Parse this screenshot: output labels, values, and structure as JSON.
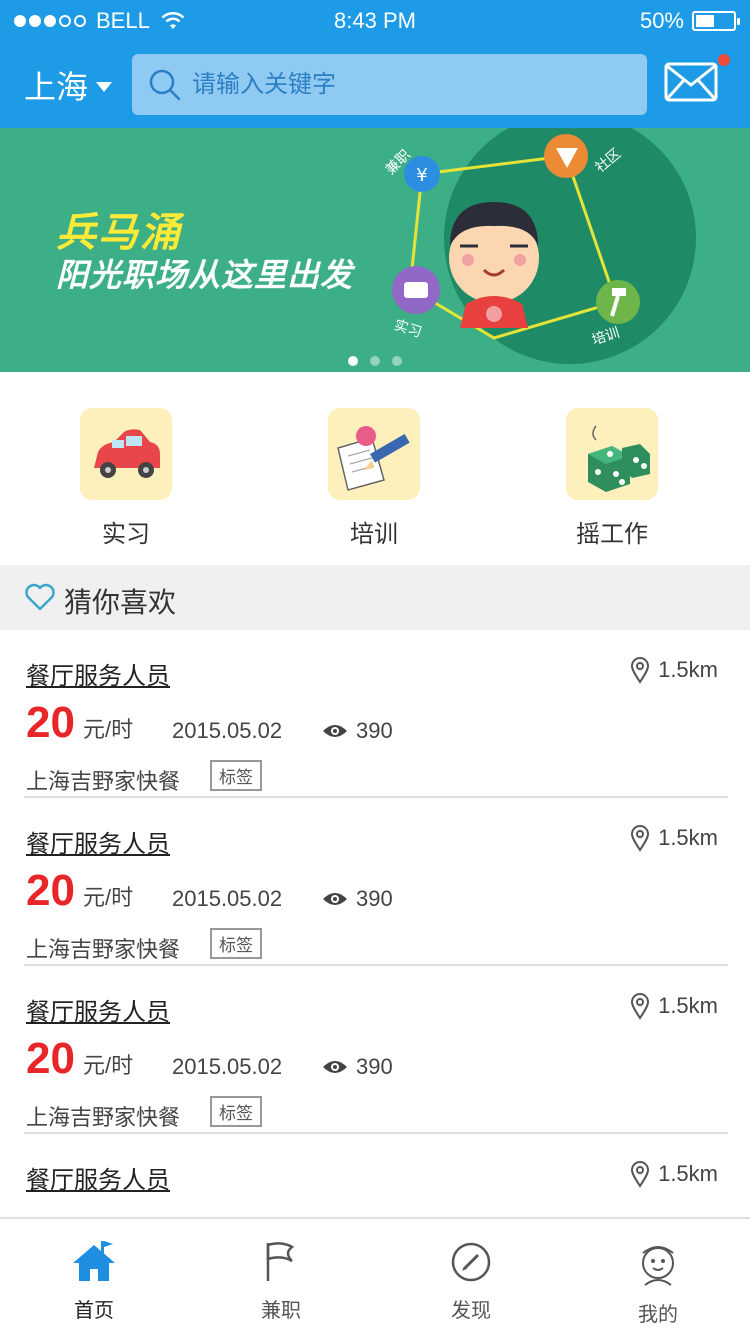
{
  "status_bar": {
    "carrier": "BELL",
    "time": "8:43 PM",
    "battery": "50%",
    "battery_fraction": 0.5,
    "signal_bars_filled": 3,
    "signal_bars_total": 5
  },
  "header": {
    "city": "上海",
    "search_placeholder": "请输入关键字",
    "has_unread_messages": true
  },
  "banner": {
    "brand": "兵马涌",
    "slogan": "阳光职场从这里出发",
    "badges": [
      "兼职",
      "社区",
      "实习",
      "培训"
    ],
    "pages": 3,
    "active_page": 1
  },
  "categories": [
    {
      "label": "实习",
      "icon": "car-icon"
    },
    {
      "label": "培训",
      "icon": "pencil-paper-icon"
    },
    {
      "label": "摇工作",
      "icon": "dice-icon"
    }
  ],
  "section": {
    "title": "猜你喜欢",
    "icon": "heart-icon"
  },
  "jobs": [
    {
      "title": "餐厅服务人员",
      "distance": "1.5km",
      "wage": "20",
      "unit": "元/时",
      "date": "2015.05.02",
      "views": "390",
      "company": "上海吉野家快餐",
      "tag": "标签"
    },
    {
      "title": "餐厅服务人员",
      "distance": "1.5km",
      "wage": "20",
      "unit": "元/时",
      "date": "2015.05.02",
      "views": "390",
      "company": "上海吉野家快餐",
      "tag": "标签"
    },
    {
      "title": "餐厅服务人员",
      "distance": "1.5km",
      "wage": "20",
      "unit": "元/时",
      "date": "2015.05.02",
      "views": "390",
      "company": "上海吉野家快餐",
      "tag": "标签"
    },
    {
      "title": "餐厅服务人员",
      "distance": "1.5km"
    }
  ],
  "tabs": [
    {
      "label": "首页",
      "icon": "home-icon",
      "active": true
    },
    {
      "label": "兼职",
      "icon": "flag-icon",
      "active": false
    },
    {
      "label": "发现",
      "icon": "compass-pen-icon",
      "active": false
    },
    {
      "label": "我的",
      "icon": "avatar-icon",
      "active": false
    }
  ],
  "colors": {
    "primary": "#1e9be6",
    "banner": "#3daf87",
    "accent_red": "#e8262a",
    "brand_yellow": "#ffea38"
  }
}
